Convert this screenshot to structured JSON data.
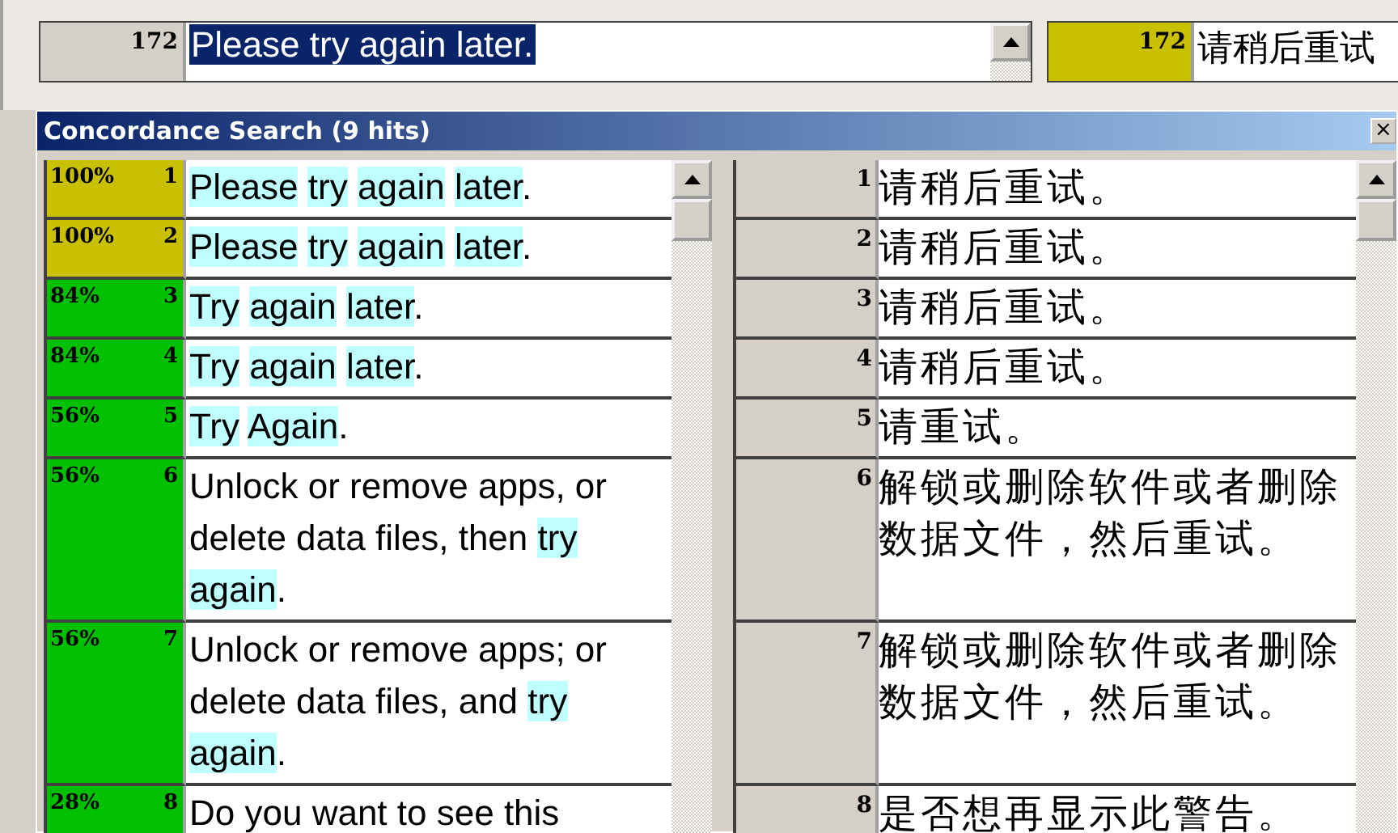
{
  "editor": {
    "source_number": "172",
    "source": {
      "text": "Please try again later.",
      "selected": true
    },
    "target_number": "172",
    "target": "请稍后重试"
  },
  "dialog": {
    "title": "Concordance Search (9 hits)",
    "close": "×",
    "hits": [
      {
        "match": "100%",
        "number": "1",
        "color": "#c8c000",
        "source": [
          {
            "t": "Please",
            "hit": true
          },
          {
            "t": "try",
            "hit": true
          },
          {
            "t": "again",
            "hit": true
          },
          {
            "t": "later",
            "hit": true,
            "tail": "."
          }
        ],
        "target_number": "1",
        "target": "请稍后重试。"
      },
      {
        "match": "100%",
        "number": "2",
        "color": "#c8c000",
        "source": [
          {
            "t": "Please",
            "hit": true
          },
          {
            "t": "try",
            "hit": true
          },
          {
            "t": "again",
            "hit": true
          },
          {
            "t": "later",
            "hit": true,
            "tail": "."
          }
        ],
        "target_number": "2",
        "target": "请稍后重试。"
      },
      {
        "match": "84%",
        "number": "3",
        "color": "#00c000",
        "source": [
          {
            "t": "Try",
            "hit": true
          },
          {
            "t": "again",
            "hit": true
          },
          {
            "t": "later",
            "hit": true,
            "tail": "."
          }
        ],
        "target_number": "3",
        "target": "请稍后重试。"
      },
      {
        "match": "84%",
        "number": "4",
        "color": "#00c000",
        "source": [
          {
            "t": "Try",
            "hit": true
          },
          {
            "t": "again",
            "hit": true
          },
          {
            "t": "later",
            "hit": true,
            "tail": "."
          }
        ],
        "target_number": "4",
        "target": "请稍后重试。"
      },
      {
        "match": "56%",
        "number": "5",
        "color": "#00c000",
        "source": [
          {
            "t": "Try",
            "hit": true
          },
          {
            "t": "Again",
            "hit": true,
            "tail": "."
          }
        ],
        "target_number": "5",
        "target": "请重试。"
      },
      {
        "match": "56%",
        "number": "6",
        "color": "#00c000",
        "source": [
          {
            "t": "Unlock or remove apps, or delete data files, then",
            "hit": false
          },
          {
            "t": "try",
            "hit": true
          },
          {
            "t": "again",
            "hit": true,
            "tail": "."
          }
        ],
        "target_number": "6",
        "target": "解锁或删除软件或者删除数据文件，然后重试。"
      },
      {
        "match": "56%",
        "number": "7",
        "color": "#00c000",
        "source": [
          {
            "t": "Unlock or remove apps; or delete data files, and",
            "hit": false
          },
          {
            "t": "try",
            "hit": true
          },
          {
            "t": "again",
            "hit": true,
            "tail": "."
          }
        ],
        "target_number": "7",
        "target": "解锁或删除软件或者删除数据文件，然后重试。"
      },
      {
        "match": "28%",
        "number": "8",
        "color": "#00c000",
        "source": [
          {
            "t": "Do you want to see this",
            "hit": false
          }
        ],
        "target_number": "8",
        "target": "是否想再显示此警告。"
      }
    ]
  }
}
